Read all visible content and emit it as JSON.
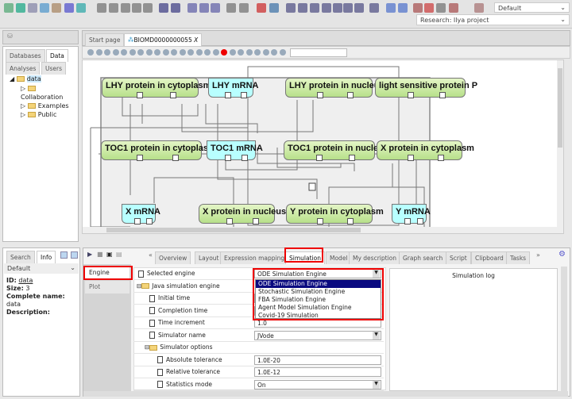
{
  "toolbar": {
    "perspective": "Default",
    "project": "Research: Ilya project"
  },
  "left_panel": {
    "tabs": [
      "Databases",
      "Data",
      "Analyses",
      "Users"
    ],
    "active_tab": "Data",
    "tree": {
      "root": "data",
      "children": [
        "Collaboration",
        "Examples",
        "Public"
      ]
    }
  },
  "editor_tabs": [
    {
      "label": "Start page"
    },
    {
      "label": "BIOMD0000000055",
      "closable": "X"
    }
  ],
  "diagram": {
    "nodes": [
      {
        "label": "LHY protein in cytoplasm",
        "kind": "protein"
      },
      {
        "label": "LHY mRNA",
        "kind": "mrna"
      },
      {
        "label": "LHY protein in nucleus",
        "kind": "protein"
      },
      {
        "label": "light sensitive protein P",
        "kind": "protein"
      },
      {
        "label": "TOC1 protein in cytoplasm",
        "kind": "protein"
      },
      {
        "label": "TOC1 mRNA",
        "kind": "mrna"
      },
      {
        "label": "TOC1 protein in nucleus",
        "kind": "protein"
      },
      {
        "label": "X protein in cytoplasm",
        "kind": "protein"
      },
      {
        "label": "X mRNA",
        "kind": "mrna"
      },
      {
        "label": "X protein in nucleus",
        "kind": "protein"
      },
      {
        "label": "Y protein in cytoplasm",
        "kind": "protein"
      },
      {
        "label": "Y mRNA",
        "kind": "mrna"
      }
    ]
  },
  "info_panel": {
    "tabs": [
      "Search",
      "Info"
    ],
    "active_tab": "Info",
    "view": "Default",
    "id_label": "ID:",
    "id": "data",
    "size_label": "Size:",
    "size": "3",
    "name_label": "Complete name:",
    "name": "data",
    "desc_label": "Description:"
  },
  "bottom_tabs": [
    "Overview",
    "Layout",
    "Expression mapping",
    "Simulation",
    "Model",
    "My description",
    "Graph search",
    "Script",
    "Clipboard",
    "Tasks"
  ],
  "active_bottom_tab": "Simulation",
  "sim_side": [
    "Engine",
    "Plot"
  ],
  "props": [
    {
      "label": "Selected engine",
      "value": "ODE Simulation Engine"
    },
    {
      "label": "Java simulation engine"
    },
    {
      "label": "Initial time"
    },
    {
      "label": "Completion time"
    },
    {
      "label": "Time increment",
      "value": "1.0"
    },
    {
      "label": "Simulator name",
      "value": "JVode"
    },
    {
      "label": "Simulator options"
    },
    {
      "label": "Absolute tolerance",
      "value": "1.0E-20"
    },
    {
      "label": "Relative tolerance",
      "value": "1.0E-12"
    },
    {
      "label": "Statistics mode",
      "value": "On"
    }
  ],
  "engine_options": [
    "ODE Simulation Engine",
    "Stochastic Simulation Engine",
    "FBA Simulation Engine",
    "Agent Model Simulation Engine",
    "Covid-19 Simulation"
  ],
  "sim_log_title": "Simulation log",
  "colors": {
    "highlight": "#e00000",
    "protein": "#c6ea9e",
    "mrna": "#b8ffff",
    "selected_option": "#0a0a80"
  }
}
